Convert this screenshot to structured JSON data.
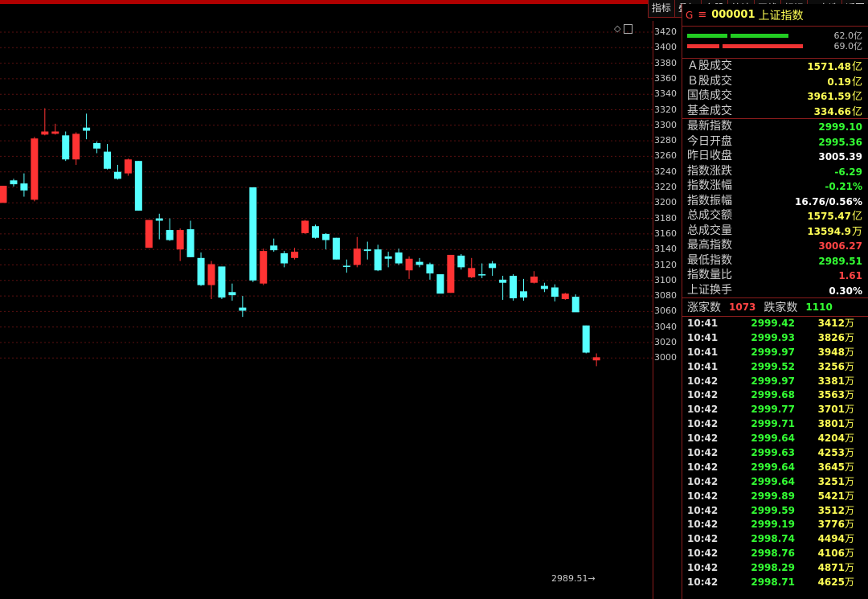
{
  "toolbar": {
    "buttons": [
      "指标",
      "叠加",
      "多股",
      "统计",
      "画线",
      "标记",
      "+自选",
      "返回"
    ]
  },
  "chart": {
    "y_ticks": [
      "3420",
      "3400",
      "3380",
      "3360",
      "3340",
      "3320",
      "3300",
      "3280",
      "3260",
      "3240",
      "3220",
      "3200",
      "3180",
      "3160",
      "3140",
      "3120",
      "3100",
      "3080",
      "3060",
      "3040",
      "3020",
      "3000"
    ],
    "min_label": "2989.51",
    "up_color": "#ff3333",
    "down_color": "#55ffff"
  },
  "chart_data": {
    "type": "candlestick",
    "ylim": [
      2989,
      3420
    ],
    "candles": [
      {
        "o": 3200,
        "c": 3222,
        "h": 3222,
        "l": 3200
      },
      {
        "o": 3229,
        "c": 3224,
        "h": 3231,
        "l": 3221
      },
      {
        "o": 3225,
        "c": 3216,
        "h": 3238,
        "l": 3208
      },
      {
        "o": 3204,
        "c": 3283,
        "h": 3285,
        "l": 3202
      },
      {
        "o": 3288,
        "c": 3292,
        "h": 3322,
        "l": 3287
      },
      {
        "o": 3289,
        "c": 3292,
        "h": 3302,
        "l": 3288
      },
      {
        "o": 3287,
        "c": 3256,
        "h": 3292,
        "l": 3254
      },
      {
        "o": 3256,
        "c": 3289,
        "h": 3291,
        "l": 3249
      },
      {
        "o": 3297,
        "c": 3293,
        "h": 3315,
        "l": 3282
      },
      {
        "o": 3277,
        "c": 3270,
        "h": 3279,
        "l": 3264
      },
      {
        "o": 3266,
        "c": 3244,
        "h": 3276,
        "l": 3243
      },
      {
        "o": 3240,
        "c": 3231,
        "h": 3249,
        "l": 3230
      },
      {
        "o": 3238,
        "c": 3256,
        "h": 3257,
        "l": 3235
      },
      {
        "o": 3254,
        "c": 3190,
        "h": 3254,
        "l": 3190
      },
      {
        "o": 3142,
        "c": 3178,
        "h": 3178,
        "l": 3142
      },
      {
        "o": 3180,
        "c": 3177,
        "h": 3186,
        "l": 3153
      },
      {
        "o": 3165,
        "c": 3152,
        "h": 3180,
        "l": 3151
      },
      {
        "o": 3140,
        "c": 3165,
        "h": 3167,
        "l": 3125
      },
      {
        "o": 3166,
        "c": 3130,
        "h": 3177,
        "l": 3130
      },
      {
        "o": 3129,
        "c": 3094,
        "h": 3136,
        "l": 3093
      },
      {
        "o": 3094,
        "c": 3121,
        "h": 3125,
        "l": 3076
      },
      {
        "o": 3118,
        "c": 3078,
        "h": 3118,
        "l": 3076
      },
      {
        "o": 3085,
        "c": 3081,
        "h": 3096,
        "l": 3074
      },
      {
        "o": 3065,
        "c": 3061,
        "h": 3080,
        "l": 3053
      },
      {
        "o": 3220,
        "c": 3100,
        "h": 3220,
        "l": 3098
      },
      {
        "o": 3096,
        "c": 3138,
        "h": 3141,
        "l": 3094
      },
      {
        "o": 3145,
        "c": 3139,
        "h": 3154,
        "l": 3137
      },
      {
        "o": 3135,
        "c": 3122,
        "h": 3138,
        "l": 3117
      },
      {
        "o": 3129,
        "c": 3137,
        "h": 3142,
        "l": 3127
      },
      {
        "o": 3161,
        "c": 3177,
        "h": 3178,
        "l": 3160
      },
      {
        "o": 3170,
        "c": 3155,
        "h": 3172,
        "l": 3154
      },
      {
        "o": 3160,
        "c": 3152,
        "h": 3161,
        "l": 3140
      },
      {
        "o": 3155,
        "c": 3127,
        "h": 3155,
        "l": 3127
      },
      {
        "o": 3119,
        "c": 3118,
        "h": 3127,
        "l": 3110
      },
      {
        "o": 3120,
        "c": 3141,
        "h": 3156,
        "l": 3117
      },
      {
        "o": 3140,
        "c": 3138,
        "h": 3150,
        "l": 3127
      },
      {
        "o": 3140,
        "c": 3113,
        "h": 3146,
        "l": 3112
      },
      {
        "o": 3131,
        "c": 3128,
        "h": 3137,
        "l": 3117
      },
      {
        "o": 3136,
        "c": 3122,
        "h": 3141,
        "l": 3120
      },
      {
        "o": 3113,
        "c": 3128,
        "h": 3131,
        "l": 3102
      },
      {
        "o": 3124,
        "c": 3120,
        "h": 3129,
        "l": 3117
      },
      {
        "o": 3121,
        "c": 3109,
        "h": 3123,
        "l": 3101
      },
      {
        "o": 3108,
        "c": 3083,
        "h": 3107,
        "l": 3086
      },
      {
        "o": 3084,
        "c": 3133,
        "h": 3133,
        "l": 3084
      },
      {
        "o": 3132,
        "c": 3117,
        "h": 3134,
        "l": 3114
      },
      {
        "o": 3104,
        "c": 3116,
        "h": 3129,
        "l": 3103
      },
      {
        "o": 3108,
        "c": 3107,
        "h": 3122,
        "l": 3103
      },
      {
        "o": 3122,
        "c": 3116,
        "h": 3125,
        "l": 3106
      },
      {
        "o": 3101,
        "c": 3097,
        "h": 3106,
        "l": 3075
      },
      {
        "o": 3106,
        "c": 3077,
        "h": 3108,
        "l": 3074
      },
      {
        "o": 3086,
        "c": 3078,
        "h": 3102,
        "l": 3074
      },
      {
        "o": 3097,
        "c": 3105,
        "h": 3112,
        "l": 3096
      },
      {
        "o": 3093,
        "c": 3089,
        "h": 3097,
        "l": 3085
      },
      {
        "o": 3091,
        "c": 3079,
        "h": 3095,
        "l": 3073
      },
      {
        "o": 3076,
        "c": 3083,
        "h": 3084,
        "l": 3075
      },
      {
        "o": 3079,
        "c": 3059,
        "h": 3082,
        "l": 3061
      },
      {
        "o": 3042,
        "c": 3007,
        "h": 3042,
        "l": 3006
      },
      {
        "o": 2997,
        "c": 3001,
        "h": 3006,
        "l": 2989.51
      }
    ]
  },
  "panel": {
    "code": "000001",
    "name": "上证指数",
    "bars": [
      {
        "value": "62.0亿",
        "color": "#22cc22"
      },
      {
        "value": "69.0亿",
        "color": "#ee3333"
      }
    ],
    "turnover": [
      {
        "label": "Ａ股成交",
        "value": "1571.48",
        "unit": "亿"
      },
      {
        "label": "Ｂ股成交",
        "value": "0.19",
        "unit": "亿"
      },
      {
        "label": "国债成交",
        "value": "3961.59",
        "unit": "亿"
      },
      {
        "label": "基金成交",
        "value": "334.66",
        "unit": "亿"
      }
    ],
    "stats": [
      {
        "label": "最新指数",
        "value": "2999.10",
        "color": "grn"
      },
      {
        "label": "今日开盘",
        "value": "2995.36",
        "color": "grn"
      },
      {
        "label": "昨日收盘",
        "value": "3005.39",
        "color": "wht"
      },
      {
        "label": "指数涨跌",
        "value": "-6.29",
        "color": "grn"
      },
      {
        "label": "指数涨幅",
        "value": "-0.21%",
        "color": "grn"
      },
      {
        "label": "指数振幅",
        "value": "16.76/0.56%",
        "color": "wht"
      },
      {
        "label": "总成交额",
        "value": "1575.47",
        "unit": "亿",
        "color": "yel"
      },
      {
        "label": "总成交量",
        "value": "13594.9",
        "unit": "万",
        "color": "yel"
      },
      {
        "label": "最高指数",
        "value": "3006.27",
        "color": "red"
      },
      {
        "label": "最低指数",
        "value": "2989.51",
        "color": "grn"
      },
      {
        "label": "指数量比",
        "value": "1.61",
        "color": "red"
      },
      {
        "label": "上证换手",
        "value": "0.30%",
        "color": "wht"
      }
    ],
    "up_label": "涨家数",
    "up_count": "1073",
    "down_label": "跌家数",
    "down_count": "1110",
    "ticks": [
      {
        "time": "10:41",
        "price": "2999.42",
        "vol": "3412"
      },
      {
        "time": "10:41",
        "price": "2999.93",
        "vol": "3826"
      },
      {
        "time": "10:41",
        "price": "2999.97",
        "vol": "3948"
      },
      {
        "time": "10:41",
        "price": "2999.52",
        "vol": "3256"
      },
      {
        "time": "10:42",
        "price": "2999.97",
        "vol": "3381"
      },
      {
        "time": "10:42",
        "price": "2999.68",
        "vol": "3563"
      },
      {
        "time": "10:42",
        "price": "2999.77",
        "vol": "3701"
      },
      {
        "time": "10:42",
        "price": "2999.71",
        "vol": "3801"
      },
      {
        "time": "10:42",
        "price": "2999.64",
        "vol": "4204"
      },
      {
        "time": "10:42",
        "price": "2999.63",
        "vol": "4253"
      },
      {
        "time": "10:42",
        "price": "2999.64",
        "vol": "3645"
      },
      {
        "time": "10:42",
        "price": "2999.64",
        "vol": "3251"
      },
      {
        "time": "10:42",
        "price": "2999.89",
        "vol": "5421"
      },
      {
        "time": "10:42",
        "price": "2999.59",
        "vol": "3512"
      },
      {
        "time": "10:42",
        "price": "2999.19",
        "vol": "3776"
      },
      {
        "time": "10:42",
        "price": "2998.74",
        "vol": "4494"
      },
      {
        "time": "10:42",
        "price": "2998.76",
        "vol": "4106"
      },
      {
        "time": "10:42",
        "price": "2998.29",
        "vol": "4871"
      },
      {
        "time": "10:42",
        "price": "2998.71",
        "vol": "4625"
      }
    ],
    "tick_unit": "万"
  }
}
